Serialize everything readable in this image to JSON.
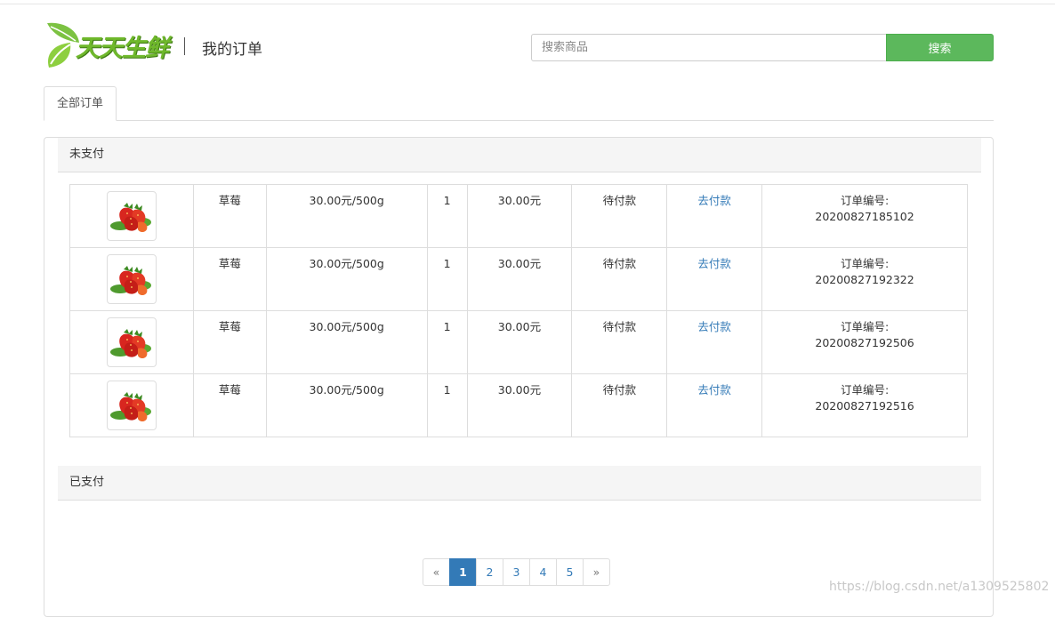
{
  "header": {
    "logo_text": "天天生鲜",
    "page_title": "我的订单",
    "search_placeholder": "搜索商品",
    "search_button": "搜索"
  },
  "tabs": [
    {
      "label": "全部订单"
    }
  ],
  "sections": {
    "unpaid": "未支付",
    "paid": "已支付"
  },
  "orders": [
    {
      "product_icon": "strawberry-image",
      "name": "草莓",
      "unit_price": "30.00元/500g",
      "quantity": "1",
      "total": "30.00元",
      "status": "待付款",
      "action": "去付款",
      "order_no_label": "订单编号:",
      "order_no": "20200827185102"
    },
    {
      "product_icon": "strawberry-image",
      "name": "草莓",
      "unit_price": "30.00元/500g",
      "quantity": "1",
      "total": "30.00元",
      "status": "待付款",
      "action": "去付款",
      "order_no_label": "订单编号:",
      "order_no": "20200827192322"
    },
    {
      "product_icon": "strawberry-image",
      "name": "草莓",
      "unit_price": "30.00元/500g",
      "quantity": "1",
      "total": "30.00元",
      "status": "待付款",
      "action": "去付款",
      "order_no_label": "订单编号:",
      "order_no": "20200827192506"
    },
    {
      "product_icon": "strawberry-image",
      "name": "草莓",
      "unit_price": "30.00元/500g",
      "quantity": "1",
      "total": "30.00元",
      "status": "待付款",
      "action": "去付款",
      "order_no_label": "订单编号:",
      "order_no": "20200827192516"
    }
  ],
  "pagination": {
    "prev": "«",
    "pages": [
      "1",
      "2",
      "3",
      "4",
      "5"
    ],
    "active_page": "1",
    "next": "»"
  },
  "watermark": "https://blog.csdn.net/a1309525802",
  "colors": {
    "brand_green": "#6fb82c",
    "search_button": "#5cb85c",
    "link_blue": "#337ab7",
    "section_bg": "#f5f5f5"
  }
}
